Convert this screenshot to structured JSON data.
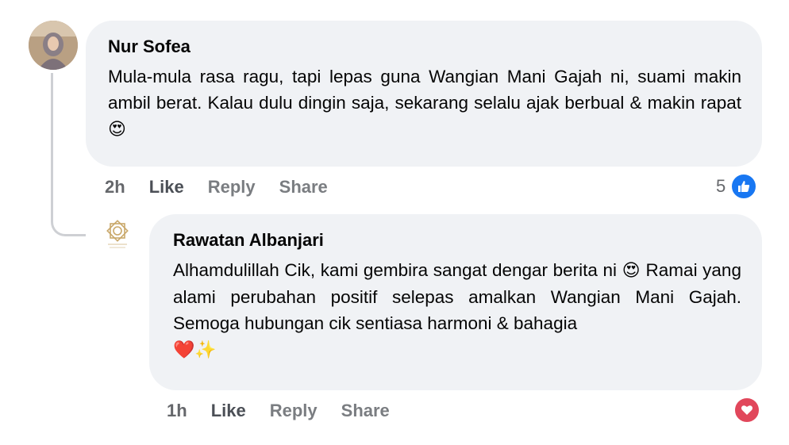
{
  "comments": [
    {
      "author": "Nur Sofea",
      "text": "Mula-mula rasa ragu, tapi lepas guna Wangian Mani Gajah ni, suami makin ambil berat. Kalau dulu dingin saja, sekarang selalu ajak berbual & makin rapat",
      "emoji": "😍",
      "time": "2h",
      "like_label": "Like",
      "reply_label": "Reply",
      "share_label": "Share",
      "reaction_count": "5",
      "reaction_icon": "like-icon"
    },
    {
      "author": "Rawatan Albanjari",
      "text_1": "Alhamdulillah Cik, kami gembira sangat dengar berita ni",
      "emoji_1": "😍",
      "text_2": "Ramai yang alami perubahan positif selepas amalkan Wangian Mani Gajah. Semoga hubungan cik sentiasa harmoni & bahagia",
      "emoji_2": "❤️✨",
      "time": "1h",
      "like_label": "Like",
      "reply_label": "Reply",
      "share_label": "Share",
      "reaction_icon": "love-icon",
      "avatar_logo_text": "Rawatan Albanjari"
    }
  ],
  "colors": {
    "bubble": "#f0f2f5",
    "action_text": "#65676b",
    "like_blue": "#1877f2",
    "love_red": "#e1475b"
  }
}
